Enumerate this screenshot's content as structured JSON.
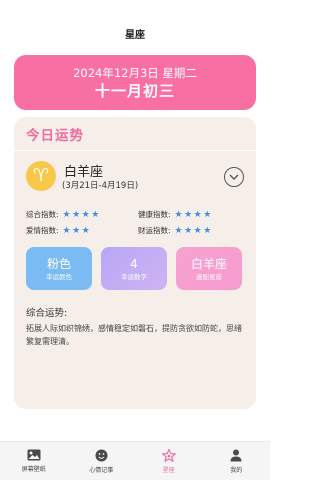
{
  "header": {
    "title": "星座"
  },
  "date_card": {
    "solar_date": "2024年12月3日 星期二",
    "lunar_date": "十一月初三"
  },
  "fortune": {
    "title": "今日运势",
    "sign": {
      "name": "白羊座",
      "range": "(3月21日-4月19日)",
      "symbol": "♈",
      "icon": "aries-icon"
    },
    "ratings": [
      {
        "label": "综合指数:",
        "stars": 4,
        "stars_text": "★★★★"
      },
      {
        "label": "健康指数:",
        "stars": 4,
        "stars_text": "★★★★"
      },
      {
        "label": "爱情指数:",
        "stars": 3,
        "stars_text": "★★★"
      },
      {
        "label": "财运指数:",
        "stars": 4,
        "stars_text": "★★★★"
      }
    ],
    "boxes": [
      {
        "value": "粉色",
        "label": "幸运颜色"
      },
      {
        "value": "4",
        "label": "幸运数字"
      },
      {
        "value": "白羊座",
        "label": "速配星座"
      }
    ],
    "summary_title": "综合运势:",
    "summary_text": "拓展人际如织锦绣，感情稳定如磐石，提防贪欲如防蛇，思绪繁复需理清。"
  },
  "tabbar": {
    "items": [
      {
        "label": "屏幕壁纸",
        "icon": "image-icon"
      },
      {
        "label": "心情记事",
        "icon": "smiley-icon"
      },
      {
        "label": "星座",
        "icon": "star-icon"
      },
      {
        "label": "我的",
        "icon": "person-icon"
      }
    ],
    "active_index": 2
  },
  "colors": {
    "accent_pink": "#f76fa3",
    "star_blue": "#3f8ee6",
    "panel_bg": "#f6eee9"
  }
}
